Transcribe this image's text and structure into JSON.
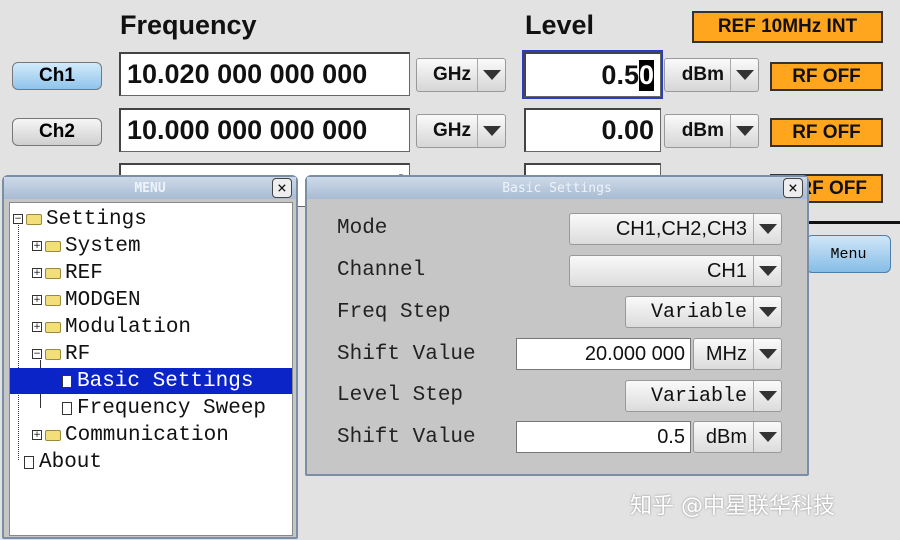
{
  "header": {
    "frequency_label": "Frequency",
    "level_label": "Level",
    "ref_button": "REF 10MHz INT"
  },
  "channels": [
    {
      "button": "Ch1",
      "frequency": "10.020 000 000 000",
      "freq_unit": "GHz",
      "level_pre": "0.5",
      "level_cursor": "0",
      "level_unit": "dBm",
      "rf": "RF OFF",
      "selected": true
    },
    {
      "button": "Ch2",
      "frequency": "10.000 000 000 000",
      "freq_unit": "GHz",
      "level": "0.00",
      "level_unit": "dBm",
      "rf": "RF OFF"
    },
    {
      "frequency_partial": "(",
      "rf": "RF OFF"
    }
  ],
  "menu_button": "Menu",
  "menu_window": {
    "title": "MENU",
    "close": "×",
    "tree": [
      {
        "label": "Settings",
        "expander": "−",
        "type": "folder-open"
      },
      {
        "label": "System",
        "expander": "+",
        "type": "folder"
      },
      {
        "label": "REF",
        "expander": "+",
        "type": "folder"
      },
      {
        "label": "MODGEN",
        "expander": "+",
        "type": "folder"
      },
      {
        "label": "Modulation",
        "expander": "+",
        "type": "folder"
      },
      {
        "label": "RF",
        "expander": "−",
        "type": "folder-open"
      },
      {
        "label": "Basic Settings",
        "type": "document",
        "selected": true
      },
      {
        "label": "Frequency Sweep",
        "type": "document"
      },
      {
        "label": "Communication",
        "expander": "+",
        "type": "folder"
      },
      {
        "label": "About",
        "type": "document"
      }
    ]
  },
  "basic_settings": {
    "title": "Basic Settings",
    "close": "×",
    "rows": [
      {
        "label": "Mode",
        "value": "CH1,CH2,CH3"
      },
      {
        "label": "Channel",
        "value": "CH1"
      },
      {
        "label": "Freq Step",
        "value": "Variable"
      },
      {
        "label": "Shift Value",
        "value": "20.000 000",
        "unit": "MHz"
      },
      {
        "label": "Level Step",
        "value": "Variable"
      },
      {
        "label": "Shift Value",
        "value": "0.5",
        "unit": "dBm"
      }
    ]
  },
  "watermark": "知乎 @中星联华科技",
  "colors": {
    "accent_orange": "#ffa51e",
    "selection": "#0a24c8",
    "ch1_button": "#a9d3f0"
  }
}
